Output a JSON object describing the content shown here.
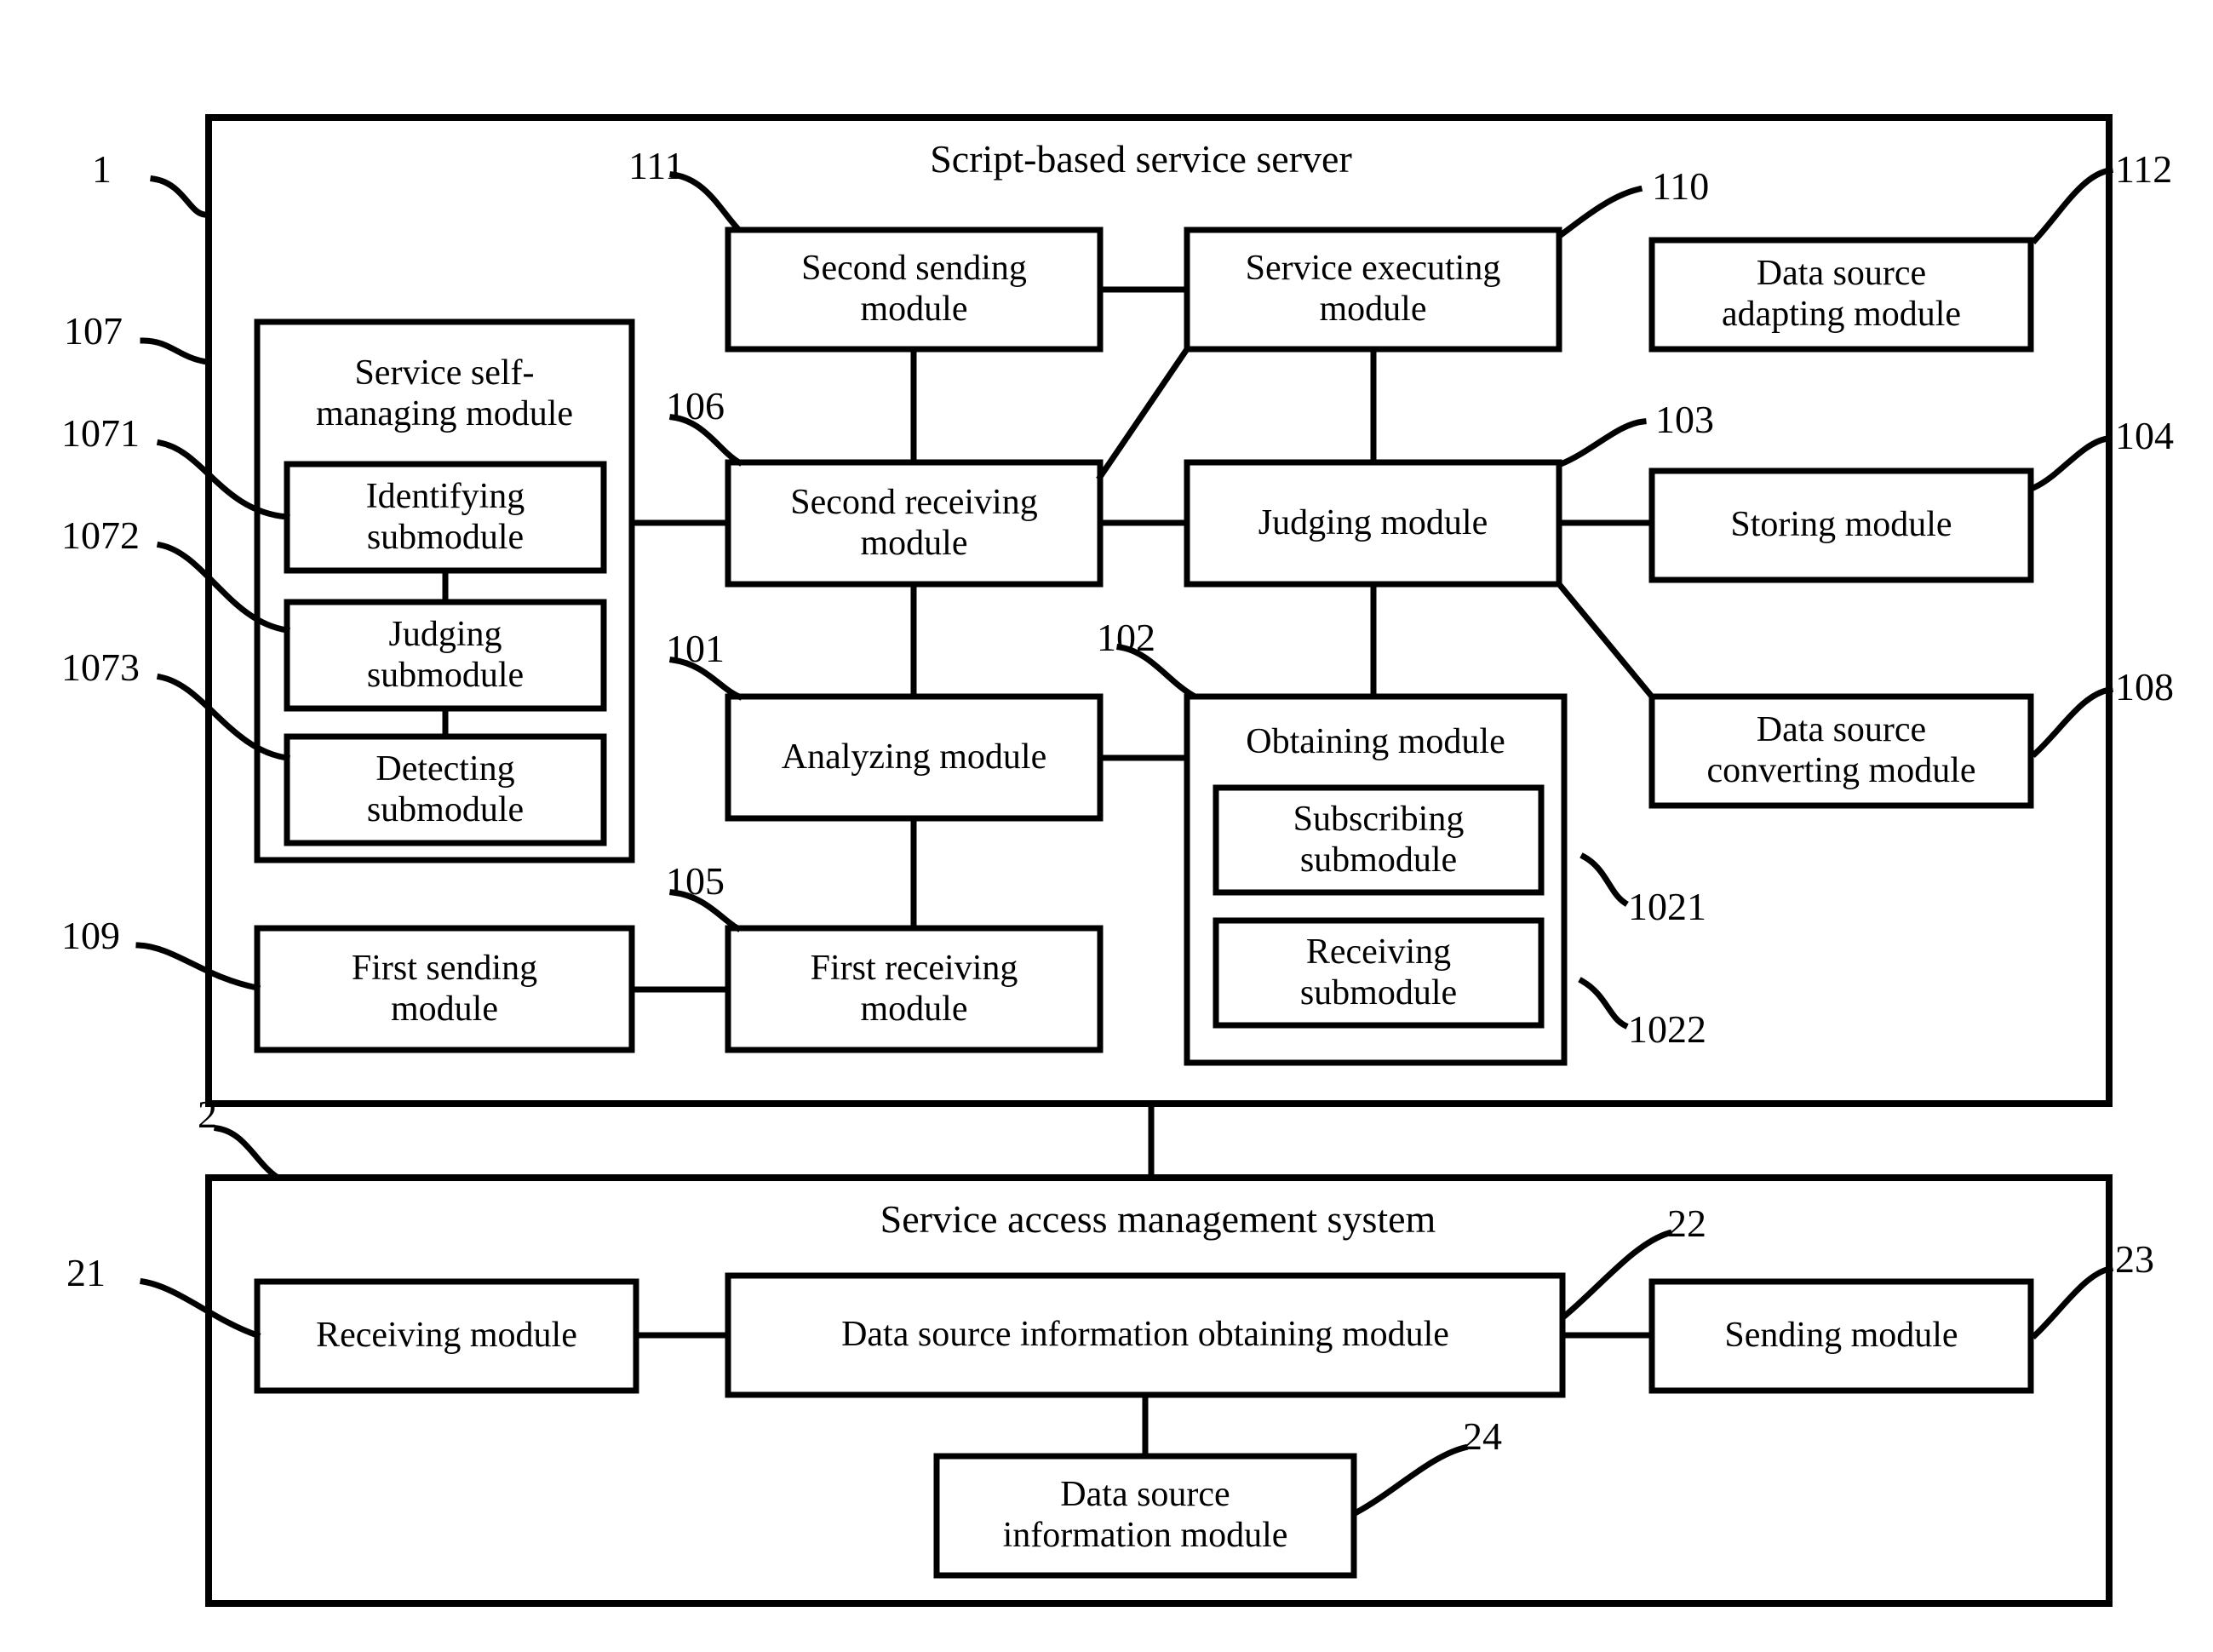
{
  "figure": {
    "background_color": "#ffffff",
    "line_color": "#000000",
    "outer_containers": [
      {
        "ref": "1",
        "title": "Script-based service server"
      },
      {
        "ref": "2",
        "title": "Service access management system"
      }
    ]
  },
  "server": {
    "ref": "1",
    "title": "Script-based service server",
    "modules": [
      {
        "ref": "111",
        "label_line1": "Second sending",
        "label_line2": "module"
      },
      {
        "ref": "110",
        "label_line1": "Service executing",
        "label_line2": "module"
      },
      {
        "ref": "112",
        "label_line1": "Data source",
        "label_line2": "adapting module"
      },
      {
        "ref": "107",
        "label_line1": "Service self-",
        "label_line2": "managing module"
      },
      {
        "ref": "1071",
        "label_line1": "Identifying",
        "label_line2": "submodule"
      },
      {
        "ref": "1072",
        "label_line1": "Judging",
        "label_line2": "submodule"
      },
      {
        "ref": "1073",
        "label_line1": "Detecting",
        "label_line2": "submodule"
      },
      {
        "ref": "106",
        "label_line1": "Second receiving",
        "label_line2": "module"
      },
      {
        "ref": "103",
        "label_line1": "Judging module",
        "label_line2": ""
      },
      {
        "ref": "104",
        "label_line1": "Storing module",
        "label_line2": ""
      },
      {
        "ref": "108",
        "label_line1": "Data source",
        "label_line2": "converting module"
      },
      {
        "ref": "101",
        "label_line1": "Analyzing module",
        "label_line2": ""
      },
      {
        "ref": "102",
        "label_line1": "Obtaining module",
        "label_line2": ""
      },
      {
        "ref": "1021",
        "label_line1": "Subscribing",
        "label_line2": "submodule"
      },
      {
        "ref": "1022",
        "label_line1": "Receiving",
        "label_line2": "submodule"
      },
      {
        "ref": "109",
        "label_line1": "First sending",
        "label_line2": "module"
      },
      {
        "ref": "105",
        "label_line1": "First receiving",
        "label_line2": "module"
      }
    ]
  },
  "management_system": {
    "ref": "2",
    "title": "Service access management system",
    "modules": [
      {
        "ref": "21",
        "label_line1": "Receiving module",
        "label_line2": ""
      },
      {
        "ref": "22",
        "label_line1": "Data source information obtaining module",
        "label_line2": ""
      },
      {
        "ref": "23",
        "label_line1": "Sending module",
        "label_line2": ""
      },
      {
        "ref": "24",
        "label_line1": "Data source",
        "label_line2": "information module"
      }
    ]
  },
  "refs": {
    "r1": "1",
    "r2": "2",
    "r21": "21",
    "r22": "22",
    "r23": "23",
    "r24": "24",
    "r101": "101",
    "r102": "102",
    "r103": "103",
    "r104": "104",
    "r105": "105",
    "r106": "106",
    "r107": "107",
    "r108": "108",
    "r109": "109",
    "r110": "110",
    "r111": "111",
    "r112": "112",
    "r1021": "1021",
    "r1022": "1022",
    "r1071": "1071",
    "r1072": "1072",
    "r1073": "1073"
  },
  "labels": {
    "server_title": "Script-based service server",
    "mgmt_title": "Service access management system",
    "second_sending_1": "Second sending",
    "second_sending_2": "module",
    "service_executing_1": "Service executing",
    "service_executing_2": "module",
    "ds_adapting_1": "Data source",
    "ds_adapting_2": "adapting module",
    "self_managing_1": "Service self-",
    "self_managing_2": "managing module",
    "identifying_1": "Identifying",
    "identifying_2": "submodule",
    "judging_sub_1": "Judging",
    "judging_sub_2": "submodule",
    "detecting_1": "Detecting",
    "detecting_2": "submodule",
    "second_receiving_1": "Second receiving",
    "second_receiving_2": "module",
    "judging_module": "Judging module",
    "storing_module": "Storing module",
    "ds_converting_1": "Data source",
    "ds_converting_2": "converting module",
    "analyzing_module": "Analyzing module",
    "obtaining_module": "Obtaining module",
    "subscribing_1": "Subscribing",
    "subscribing_2": "submodule",
    "receiving_sub_1": "Receiving",
    "receiving_sub_2": "submodule",
    "first_sending_1": "First sending",
    "first_sending_2": "module",
    "first_receiving_1": "First receiving",
    "first_receiving_2": "module",
    "receiving_module": "Receiving module",
    "ds_info_obtaining": "Data source information obtaining module",
    "sending_module": "Sending module",
    "ds_info_1": "Data source",
    "ds_info_2": "information module"
  }
}
